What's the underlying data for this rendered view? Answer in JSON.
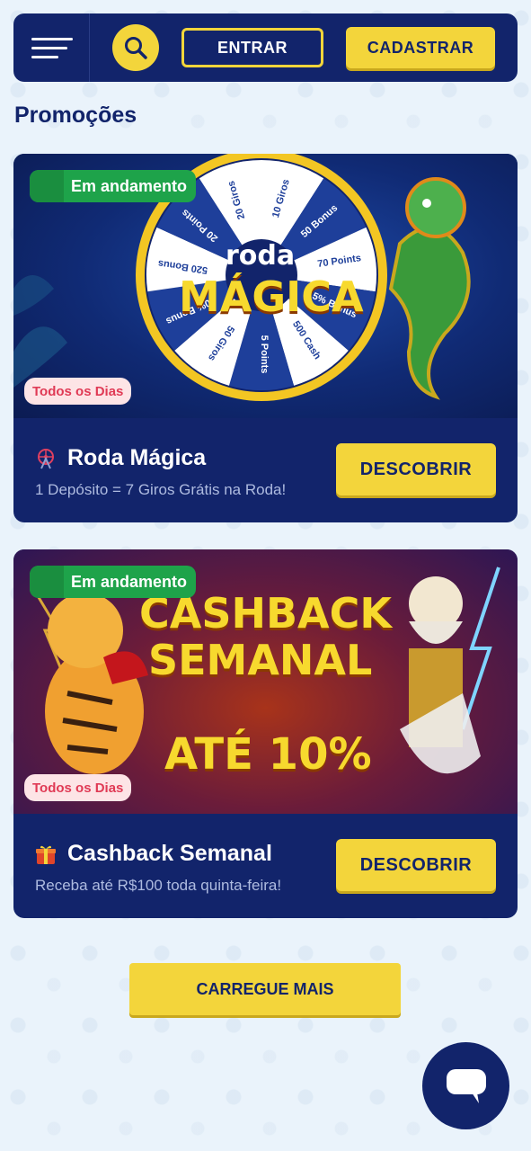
{
  "header": {
    "login_label": "ENTRAR",
    "register_label": "CADASTRAR"
  },
  "page": {
    "title": "Promoções"
  },
  "promos": [
    {
      "status": "Em andamento",
      "frequency": "Todos os Dias",
      "icon": "ferris-wheel-icon",
      "title": "Roda Mágica",
      "subtitle": "1 Depósito = 7 Giros Grátis na Roda!",
      "button_label": "DESCOBRIR",
      "banner": {
        "line1": "roda",
        "line2": "MÁGICA",
        "wheel_segments": [
          "10 Giros",
          "50 Bonus",
          "70 Points",
          "5% Bonus",
          "500 Cash",
          "5 Points",
          "50 Giros",
          "50% Bonus",
          "520 Bonus",
          "20 Points",
          "20 Giros"
        ]
      }
    },
    {
      "status": "Em andamento",
      "frequency": "Todos os Dias",
      "icon": "gift-icon",
      "title": "Cashback Semanal",
      "subtitle": "Receba até R$100 toda quinta-feira!",
      "button_label": "DESCOBRIR",
      "banner": {
        "line1": "CASHBACK",
        "line2": "SEMANAL",
        "line3": "ATÉ 10%"
      }
    }
  ],
  "load_more_label": "CARREGUE MAIS",
  "colors": {
    "navy": "#12246b",
    "yellow": "#f3d53b",
    "green": "#1ea34a",
    "background": "#eaf3fb"
  }
}
